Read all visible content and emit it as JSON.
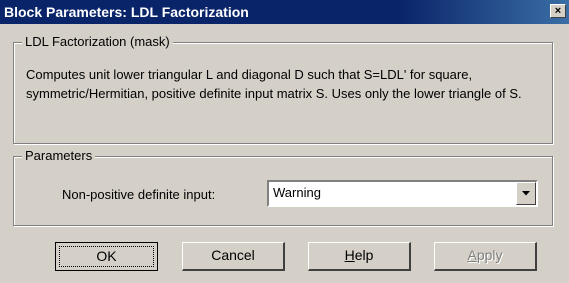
{
  "window": {
    "title": "Block Parameters: LDL Factorization",
    "close_glyph": "×"
  },
  "mask_group": {
    "label": "LDL Factorization (mask)",
    "description": "Computes unit lower triangular L and diagonal D such that S=LDL' for square, symmetric/Hermitian, positive definite input matrix S. Uses only the lower triangle of S."
  },
  "params_group": {
    "label": "Parameters",
    "non_positive_label": "Non-positive definite input:",
    "non_positive_value": "Warning"
  },
  "buttons": {
    "ok": "OK",
    "cancel": "Cancel",
    "help_mnemonic": "H",
    "help_rest": "elp",
    "apply_mnemonic": "A",
    "apply_rest": "pply"
  },
  "icons": {
    "close": "close-icon",
    "dropdown": "chevron-down-icon"
  }
}
